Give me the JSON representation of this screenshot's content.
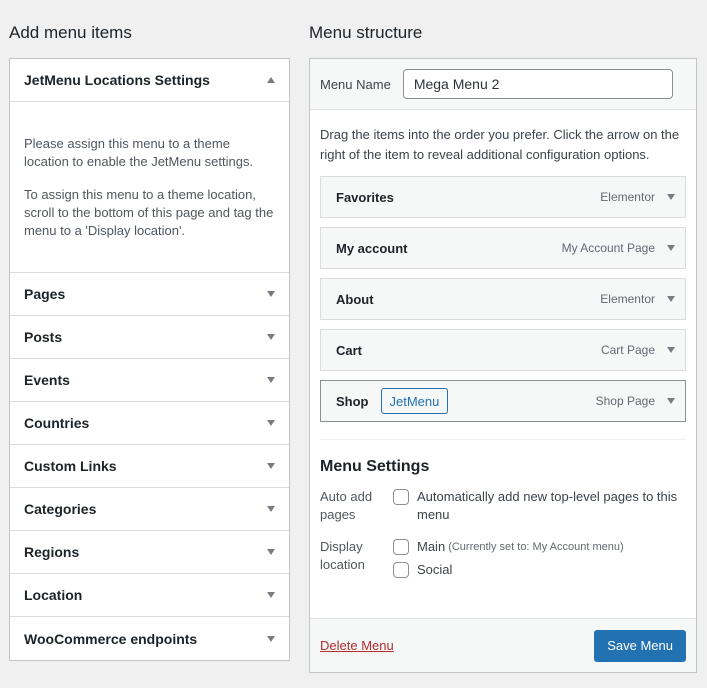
{
  "left": {
    "title": "Add menu items",
    "jetmenu": {
      "heading": "JetMenu Locations Settings",
      "para1": "Please assign this menu to a theme location to enable the JetMenu settings.",
      "para2": "To assign this menu to a theme location, scroll to the bottom of this page and tag the menu to a 'Display location'."
    },
    "sections": [
      "Pages",
      "Posts",
      "Events",
      "Countries",
      "Custom Links",
      "Categories",
      "Regions",
      "Location",
      "WooCommerce endpoints"
    ]
  },
  "right": {
    "title": "Menu structure",
    "name_label": "Menu Name",
    "name_value": "Mega Menu 2",
    "instructions": "Drag the items into the order you prefer. Click the arrow on the right of the item to reveal additional configuration options.",
    "items": [
      {
        "title": "Favorites",
        "type": "Elementor"
      },
      {
        "title": "My account",
        "type": "My Account Page"
      },
      {
        "title": "About",
        "type": "Elementor"
      },
      {
        "title": "Cart",
        "type": "Cart Page"
      },
      {
        "title": "Shop",
        "type": "Shop Page",
        "badge": "JetMenu"
      }
    ],
    "settings": {
      "title": "Menu Settings",
      "auto_add_label": "Auto add pages",
      "auto_add_option": "Automatically add new top-level pages to this menu",
      "display_label": "Display location",
      "main_label": "Main",
      "main_note": "(Currently set to: My Account menu)",
      "social_label": "Social"
    },
    "delete_label": "Delete Menu",
    "save_label": "Save Menu"
  },
  "colors": {
    "accent": "#2271b1",
    "danger": "#b32d2e",
    "background": "#f0f0f1"
  }
}
